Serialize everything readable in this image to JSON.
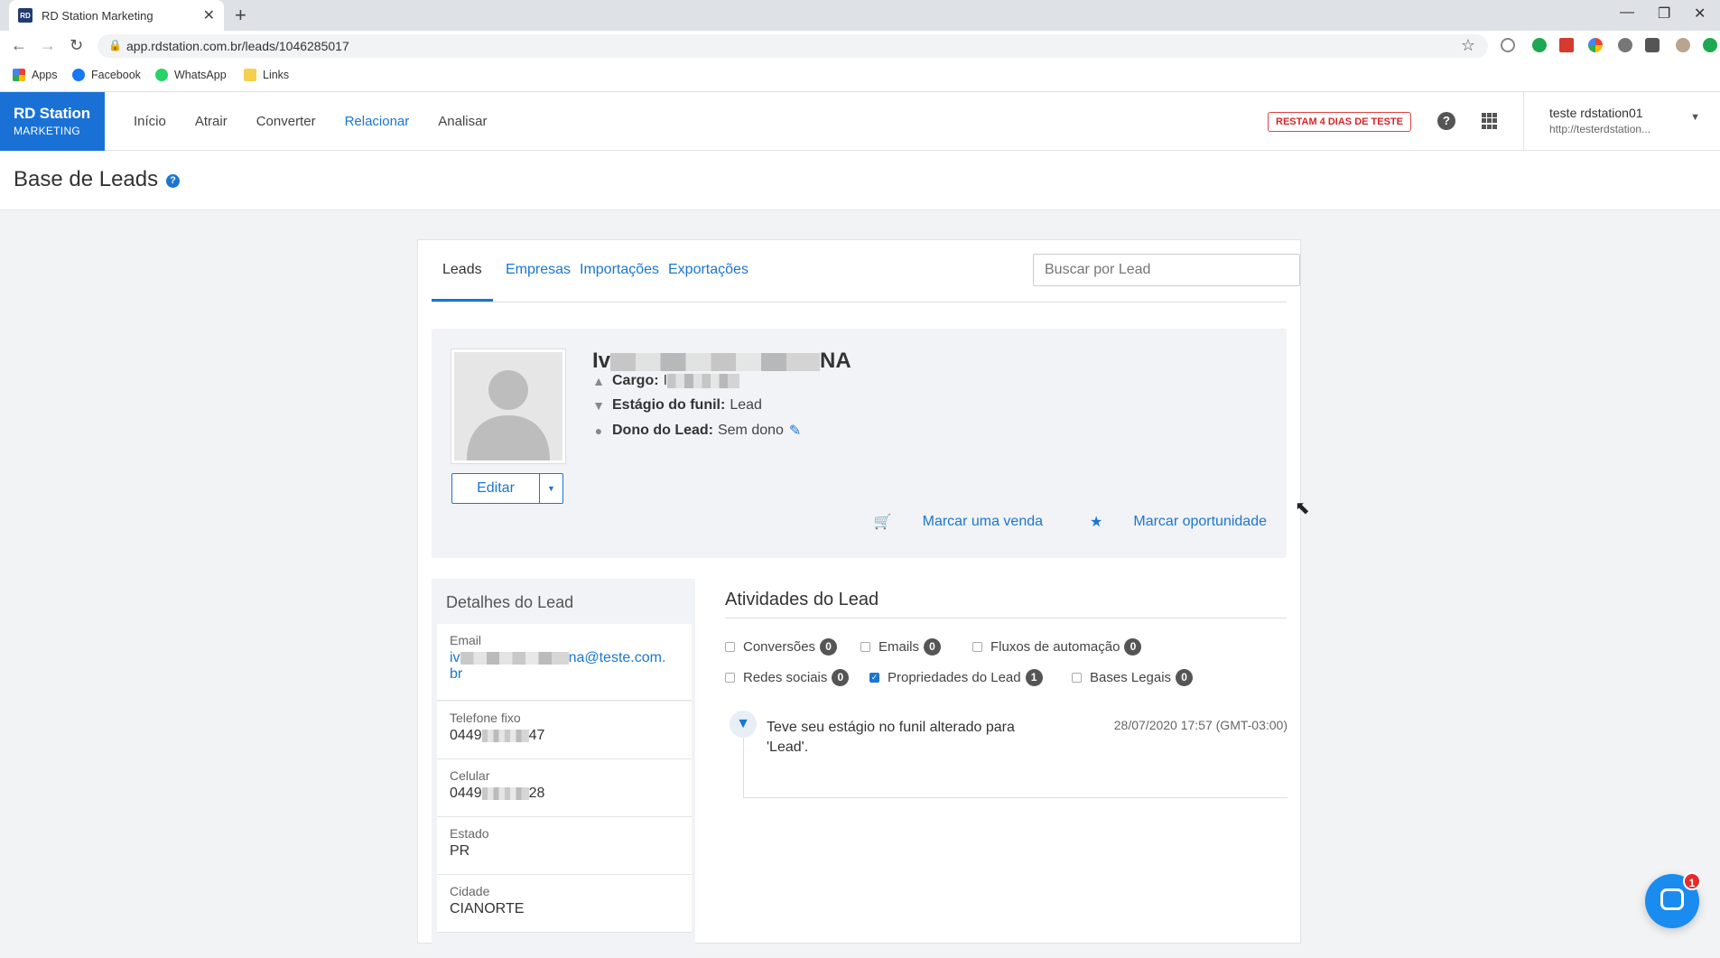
{
  "browser": {
    "tab_title": "RD Station Marketing",
    "tab_favicon_text": "RD",
    "url": "app.rdstation.com.br/leads/1046285017",
    "bookmarks": [
      "Apps",
      "Facebook",
      "WhatsApp",
      "Links"
    ]
  },
  "app": {
    "logo_line1": "RD Station",
    "logo_line2": "MARKETING",
    "nav": [
      "Início",
      "Atrair",
      "Converter",
      "Relacionar",
      "Analisar"
    ],
    "nav_active": "Relacionar",
    "trial_badge": "RESTAM 4 DIAS DE TESTE",
    "account_name": "teste rdstation01",
    "account_url": "http://testerdstation..."
  },
  "page": {
    "title": "Base de Leads"
  },
  "tabs": [
    "Leads",
    "Empresas",
    "Importações",
    "Exportações"
  ],
  "search": {
    "placeholder": "Buscar por Lead"
  },
  "lead": {
    "name_start": "Iv",
    "name_end": "NA",
    "cargo_label": "Cargo:",
    "cargo_value": "I",
    "funil_label": "Estágio do funil:",
    "funil_value": "Lead",
    "dono_label": "Dono do Lead:",
    "dono_value": "Sem dono",
    "edit_label": "Editar",
    "action_sale": "Marcar uma venda",
    "action_opportunity": "Marcar oportunidade"
  },
  "details": {
    "title": "Detalhes do Lead",
    "fields": [
      {
        "label": "Email",
        "value_start": "iv",
        "value_end": "na@teste.com.",
        "value_line2": "br"
      },
      {
        "label": "Telefone fixo",
        "value_start": "0449",
        "value_end": "47"
      },
      {
        "label": "Celular",
        "value_start": "0449",
        "value_end": "28"
      },
      {
        "label": "Estado",
        "value": "PR"
      },
      {
        "label": "Cidade",
        "value": "CIANORTE"
      }
    ]
  },
  "activities": {
    "title": "Atividades do Lead",
    "filters": [
      {
        "label": "Conversões",
        "count": "0",
        "checked": false
      },
      {
        "label": "Emails",
        "count": "0",
        "checked": false
      },
      {
        "label": "Fluxos de automação",
        "count": "0",
        "checked": false
      },
      {
        "label": "Redes sociais",
        "count": "0",
        "checked": false
      },
      {
        "label": "Propriedades do Lead",
        "count": "1",
        "checked": true
      },
      {
        "label": "Bases Legais",
        "count": "0",
        "checked": false
      }
    ],
    "events": [
      {
        "text": "Teve seu estágio no funil alterado para 'Lead'.",
        "date": "28/07/2020 17:57 (GMT-03:00)"
      }
    ]
  },
  "chat": {
    "badge": "1"
  },
  "colors": {
    "brand": "#1971d6",
    "link": "#1a76d2",
    "trial": "#d9262a"
  }
}
